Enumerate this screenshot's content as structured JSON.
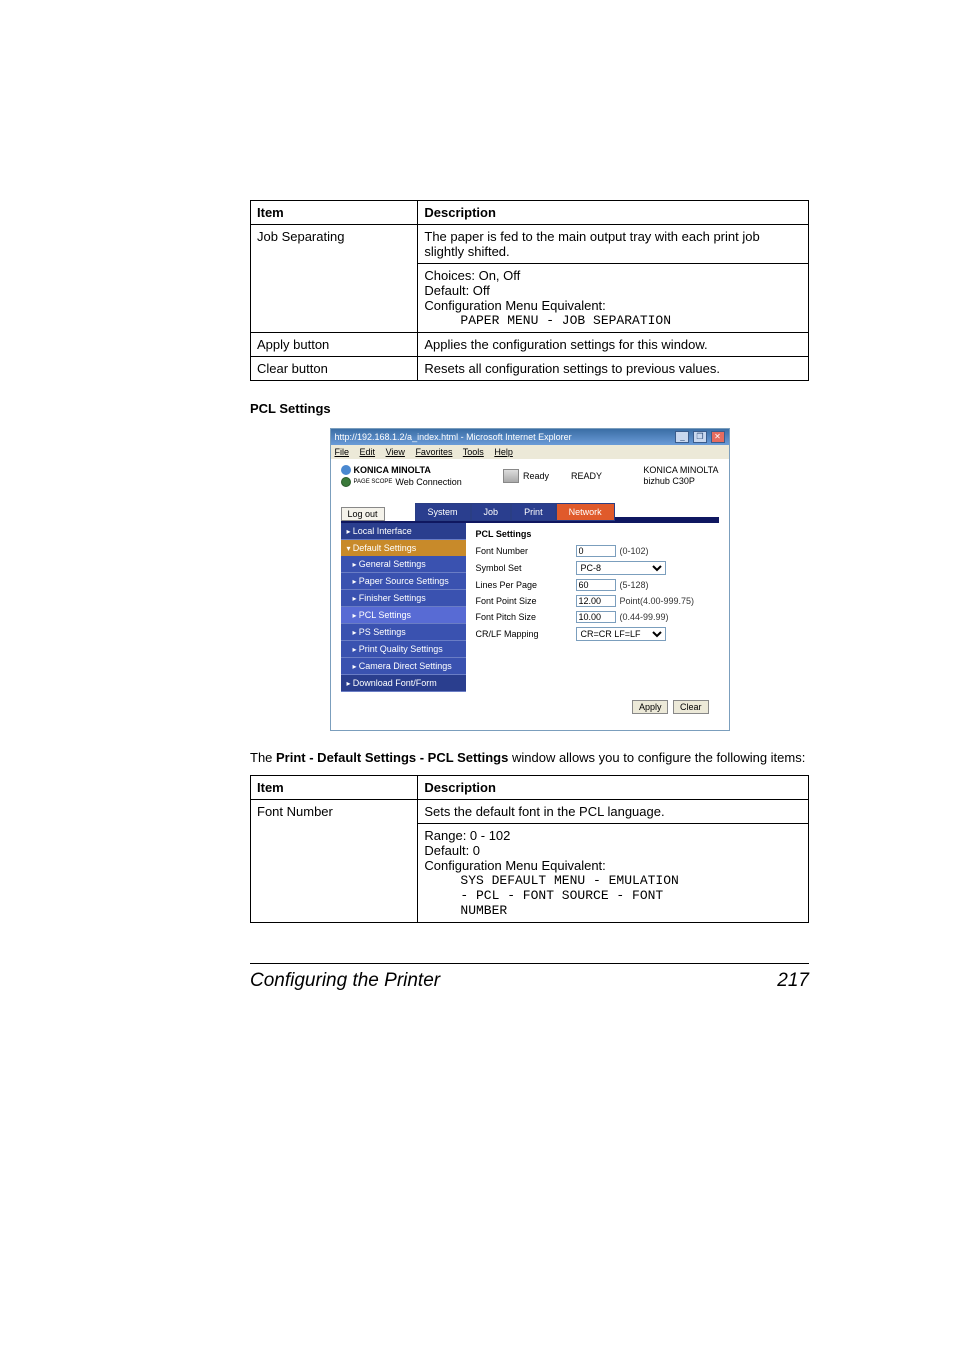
{
  "table1": {
    "h1": "Item",
    "h2": "Description",
    "r1": {
      "item": "Job Separating",
      "p1": "The paper is fed to the main output tray with each print job slightly shifted.",
      "choices": "Choices: On, Off",
      "default": "Default:  Off",
      "cme": "Configuration Menu Equivalent:",
      "path": "PAPER MENU - JOB SEPARATION"
    },
    "r2": {
      "item": "Apply button",
      "desc": "Applies the configuration settings for this window."
    },
    "r3": {
      "item": "Clear button",
      "desc": "Resets all configuration settings to previous values."
    }
  },
  "section_header": "PCL Settings",
  "ie": {
    "title": "http://192.168.1.2/a_index.html - Microsoft Internet Explorer",
    "menu": {
      "file": "File",
      "edit": "Edit",
      "view": "View",
      "fav": "Favorites",
      "tools": "Tools",
      "help": "Help"
    },
    "brand": "KONICA MINOLTA",
    "webconn_prefix": "PAGE SCOPE",
    "webconn": "Web Connection",
    "status_word": "Ready",
    "status_big": "READY",
    "model_line1": "KONICA MINOLTA",
    "model_line2": "bizhub C30P",
    "logout": "Log out",
    "tabs": {
      "system": "System",
      "job": "Job",
      "print": "Print",
      "network": "Network"
    },
    "sidebar": {
      "local": "Local Interface",
      "default": "Default Settings",
      "general": "General Settings",
      "paper": "Paper Source Settings",
      "finisher": "Finisher Settings",
      "pcl": "PCL Settings",
      "ps": "PS Settings",
      "pq": "Print Quality Settings",
      "camera": "Camera Direct Settings",
      "download": "Download Font/Form"
    },
    "panel": {
      "heading": "PCL Settings",
      "font_number": "Font Number",
      "font_number_val": "0",
      "font_number_hint": "(0-102)",
      "symbol_set": "Symbol Set",
      "symbol_set_val": "PC-8",
      "lines": "Lines Per Page",
      "lines_val": "60",
      "lines_hint": "(5-128)",
      "fps": "Font Point Size",
      "fps_val": "12.00",
      "fps_hint": "Point(4.00-999.75)",
      "fpitch": "Font Pitch Size",
      "fpitch_val": "10.00",
      "fpitch_hint": "(0.44-99.99)",
      "crlf": "CR/LF Mapping",
      "crlf_val": "CR=CR LF=LF",
      "apply": "Apply",
      "clear": "Clear"
    }
  },
  "paragraph_pre": "The ",
  "paragraph_bold": "Print - Default Settings - PCL Settings",
  "paragraph_post": " window allows you to configure the following items:",
  "table2": {
    "h1": "Item",
    "h2": "Description",
    "r1": {
      "item": "Font Number",
      "desc": "Sets the default font in the PCL language.",
      "range": "Range:   0 - 102",
      "default": "Default:  0",
      "cme": "Configuration Menu Equivalent:",
      "path1": "SYS DEFAULT MENU - EMULATION",
      "path2": "- PCL - FONT SOURCE - FONT",
      "path3": "NUMBER"
    }
  },
  "footer": {
    "left": "Configuring the Printer",
    "right": "217"
  }
}
